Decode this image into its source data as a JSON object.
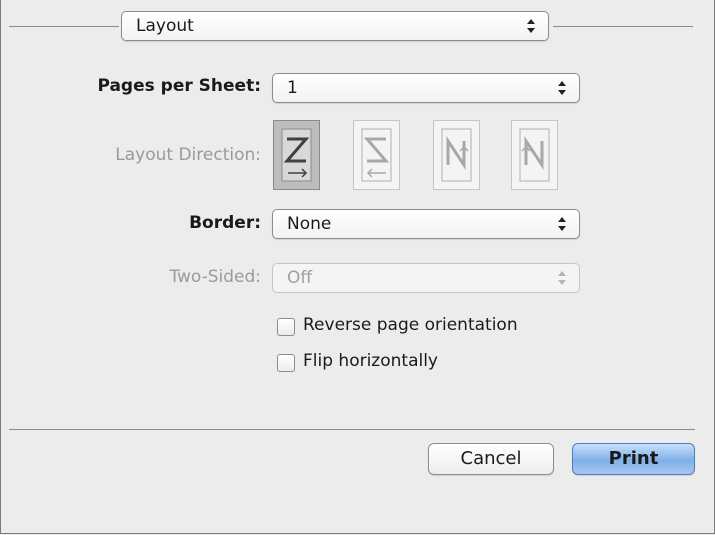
{
  "header": {
    "section_popup": "Layout"
  },
  "form": {
    "pages_per_sheet": {
      "label": "Pages per Sheet:",
      "value": "1"
    },
    "layout_direction": {
      "label": "Layout Direction:"
    },
    "border": {
      "label": "Border:",
      "value": "None"
    },
    "two_sided": {
      "label": "Two-Sided:",
      "value": "Off"
    },
    "checkboxes": [
      {
        "label": "Reverse page orientation",
        "checked": false
      },
      {
        "label": "Flip horizontally",
        "checked": false
      }
    ]
  },
  "buttons": {
    "cancel": "Cancel",
    "print": "Print"
  }
}
